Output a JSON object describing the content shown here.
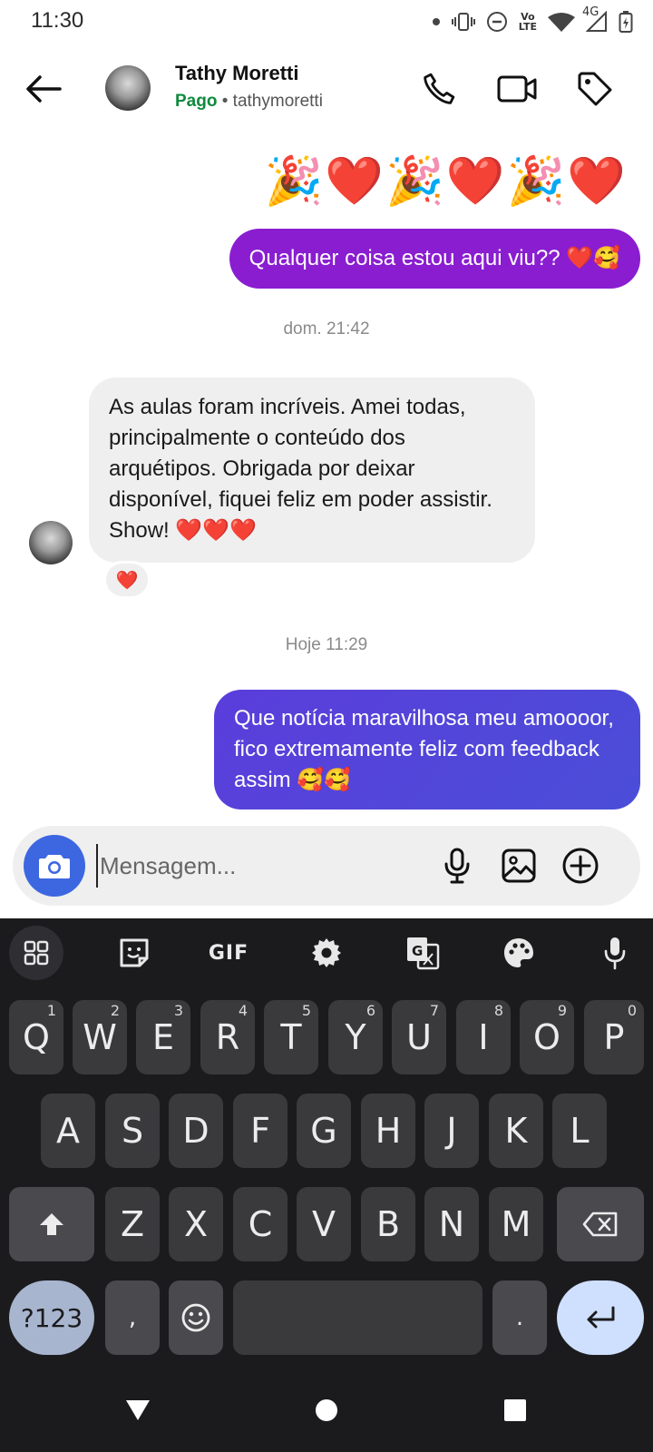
{
  "status_bar": {
    "time": "11:30",
    "volte_top": "Vo",
    "volte_bottom": "LTE",
    "network": "4G"
  },
  "header": {
    "contact_name": "Tathy Moretti",
    "status": "Pago",
    "separator": " • ",
    "username": "tathymoretti"
  },
  "messages": {
    "emoji_row": "🎉❤️🎉❤️🎉❤️",
    "outgoing_1": "Qualquer coisa estou aqui viu?? ❤️🥰",
    "timestamp_1": "dom. 21:42",
    "incoming_1": "As aulas foram incríveis. Amei todas, principalmente o conteúdo dos arquétipos. Obrigada por deixar disponível, fiquei feliz em poder assistir. Show! ❤️❤️❤️",
    "incoming_1_reaction": "❤️",
    "timestamp_2": "Hoje 11:29",
    "outgoing_2": "Que notícia maravilhosa meu amoooor, fico extremamente feliz com feedback assim 🥰🥰"
  },
  "composer": {
    "placeholder": "Mensagem..."
  },
  "keyboard": {
    "toolbar_gif": "GIF",
    "row1": [
      {
        "key": "Q",
        "hint": "1"
      },
      {
        "key": "W",
        "hint": "2"
      },
      {
        "key": "E",
        "hint": "3"
      },
      {
        "key": "R",
        "hint": "4"
      },
      {
        "key": "T",
        "hint": "5"
      },
      {
        "key": "Y",
        "hint": "6"
      },
      {
        "key": "U",
        "hint": "7"
      },
      {
        "key": "I",
        "hint": "8"
      },
      {
        "key": "O",
        "hint": "9"
      },
      {
        "key": "P",
        "hint": "0"
      }
    ],
    "row2": [
      "A",
      "S",
      "D",
      "F",
      "G",
      "H",
      "J",
      "K",
      "L"
    ],
    "row3": [
      "Z",
      "X",
      "C",
      "V",
      "B",
      "N",
      "M"
    ],
    "symbols_label": "?123",
    "comma": ",",
    "period": "."
  },
  "colors": {
    "outgoing_purple": "#8a1dd0",
    "outgoing_blue": "#4a4ed8",
    "incoming_gray": "#efefef",
    "paid_green": "#0f8a3f",
    "camera_blue": "#3d67e0",
    "keyboard_bg": "#1b1b1d"
  }
}
